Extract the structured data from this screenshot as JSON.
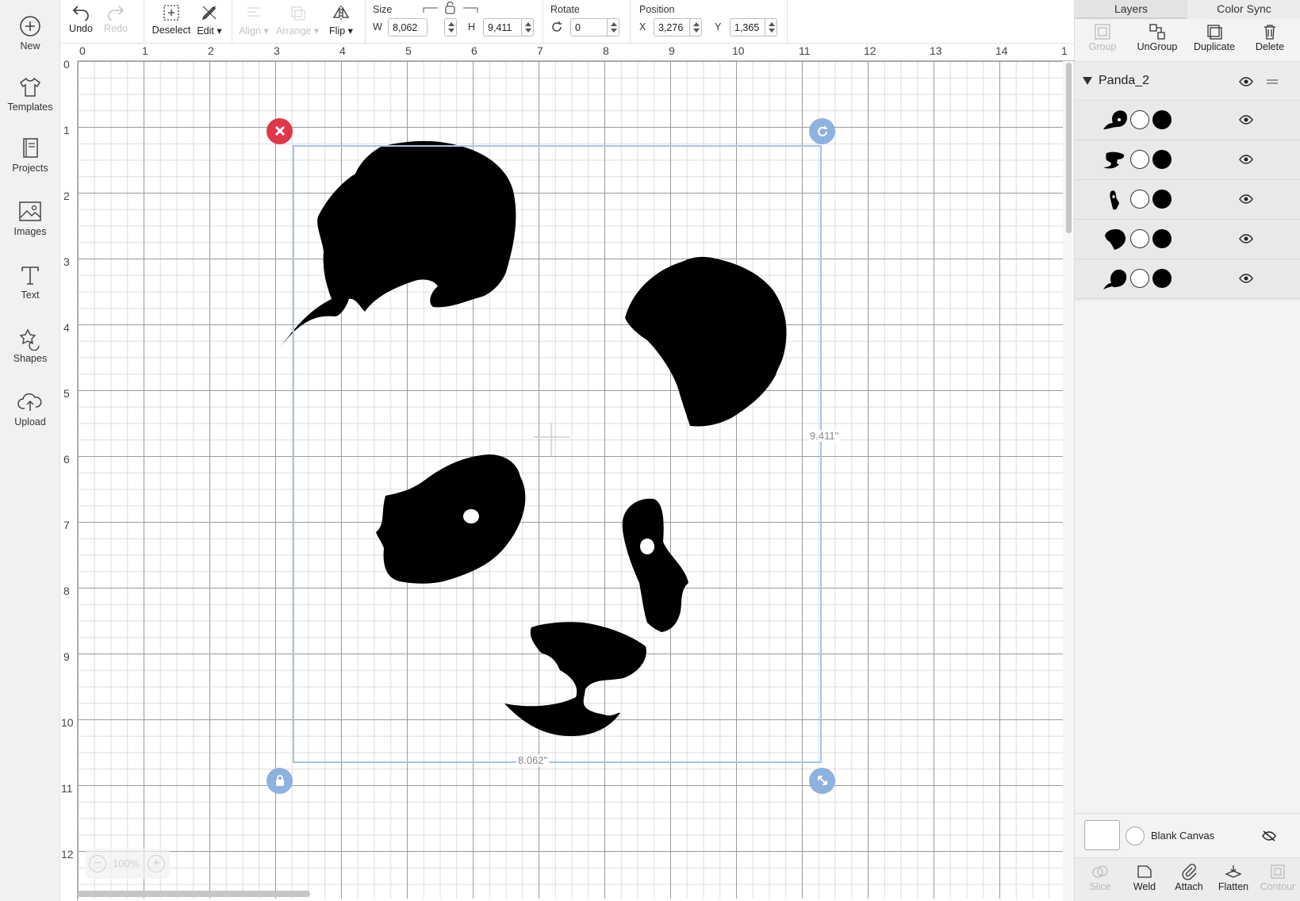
{
  "sidebar": {
    "items": [
      {
        "label": "New",
        "icon": "plus-circle-icon"
      },
      {
        "label": "Templates",
        "icon": "tshirt-icon"
      },
      {
        "label": "Projects",
        "icon": "book-icon"
      },
      {
        "label": "Images",
        "icon": "image-icon"
      },
      {
        "label": "Text",
        "icon": "text-icon"
      },
      {
        "label": "Shapes",
        "icon": "shapes-icon"
      },
      {
        "label": "Upload",
        "icon": "cloud-upload-icon"
      }
    ]
  },
  "toolbar": {
    "undo_label": "Undo",
    "redo_label": "Redo",
    "deselect_label": "Deselect",
    "edit_label": "Edit",
    "align_label": "Align",
    "arrange_label": "Arrange",
    "flip_label": "Flip",
    "size": {
      "title": "Size",
      "w_label": "W",
      "w_value": "8,062",
      "h_label": "H",
      "h_value": "9,411"
    },
    "rotate": {
      "title": "Rotate",
      "value": "0"
    },
    "position": {
      "title": "Position",
      "x_label": "X",
      "x_value": "3,276",
      "y_label": "Y",
      "y_value": "1,365"
    }
  },
  "canvas": {
    "ruler_x": [
      "0",
      "1",
      "2",
      "3",
      "4",
      "5",
      "6",
      "7",
      "8",
      "9",
      "10",
      "11",
      "12",
      "13",
      "14",
      "1"
    ],
    "ruler_y": [
      "0",
      "1",
      "2",
      "3",
      "4",
      "5",
      "6",
      "7",
      "8",
      "9",
      "10",
      "11",
      "12"
    ],
    "width_dim": "8.062\"",
    "height_dim": "9.411\"",
    "zoom": "100%"
  },
  "panel": {
    "tabs": [
      "Layers",
      "Color Sync"
    ],
    "tools": {
      "group": "Group",
      "ungroup": "UnGroup",
      "duplicate": "Duplicate",
      "delete": "Delete"
    },
    "group_name": "Panda_2",
    "layers": [
      {
        "shape": "ear-left"
      },
      {
        "shape": "nose"
      },
      {
        "shape": "eye-right"
      },
      {
        "shape": "ear-right"
      },
      {
        "shape": "eye-left"
      }
    ],
    "layer_color": "#000000",
    "blank_canvas_label": "Blank Canvas",
    "bottom_tools": {
      "slice": "Slice",
      "weld": "Weld",
      "attach": "Attach",
      "flatten": "Flatten",
      "contour": "Contour"
    }
  },
  "colors": {
    "delete_handle": "#e0364a",
    "handle": "#8fb1de",
    "selection": "#a9c3e5"
  }
}
